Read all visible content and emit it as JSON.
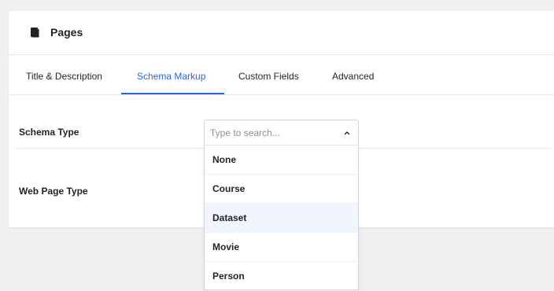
{
  "header": {
    "title": "Pages",
    "icon": "pages-icon"
  },
  "tabs": [
    {
      "label": "Title & Description",
      "active": false
    },
    {
      "label": "Schema Markup",
      "active": true
    },
    {
      "label": "Custom Fields",
      "active": false
    },
    {
      "label": "Advanced",
      "active": false
    }
  ],
  "colors": {
    "accent": "#2563eb",
    "highlight": "#f0f5ff"
  },
  "fields": {
    "schema_type_label": "Schema Type",
    "web_page_type_label": "Web Page Type"
  },
  "schema_select": {
    "placeholder": "Type to search...",
    "value": "",
    "options": [
      {
        "label": "None",
        "highlighted": false
      },
      {
        "label": "Course",
        "highlighted": false
      },
      {
        "label": "Dataset",
        "highlighted": true
      },
      {
        "label": "Movie",
        "highlighted": false
      },
      {
        "label": "Person",
        "highlighted": false
      }
    ]
  }
}
